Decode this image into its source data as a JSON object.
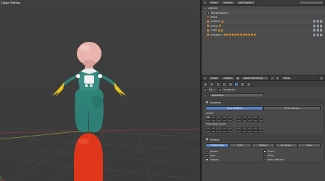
{
  "viewport": {
    "label": "User Ortho",
    "colors": {
      "background": "#3d3d3d",
      "skin": "#e8b4ad",
      "teal": "#2e8077",
      "yellow": "#e6c21c",
      "red": "#e0361a"
    }
  },
  "outliner_header": {
    "view": "View",
    "search": "Search",
    "scenes": "All Scenes"
  },
  "outliner": {
    "items": [
      {
        "label": "Untitled"
      },
      {
        "label": "RenderLayers"
      },
      {
        "label": "World"
      },
      {
        "label": "Camera"
      },
      {
        "label": "Lamp"
      },
      {
        "label": "Cube"
      },
      {
        "label": "Armature"
      }
    ]
  },
  "props_header": {
    "view": "View",
    "image": "Image",
    "datablock": "AB0TUSE:0026",
    "view2": "View"
  },
  "breadcrumb": {
    "object": "Fig",
    "data": "Armature"
  },
  "name_field": "Armature",
  "skeleton": {
    "title": "Skeleton",
    "pose_position": "Pose Position",
    "rest_position": "Rest Position",
    "layers_label": "Layers:",
    "protected_label": "Protected Layers:"
  },
  "display": {
    "title": "Display",
    "tabs": [
      "Octahedral",
      "Stick",
      "B-Bone",
      "Envelope",
      "Wire"
    ],
    "options": [
      {
        "label": "Names",
        "checked": false
      },
      {
        "label": "Colors",
        "checked": true
      },
      {
        "label": "Axes",
        "checked": false
      },
      {
        "label": "X-Ray",
        "checked": false
      },
      {
        "label": "Shapes",
        "checked": true
      },
      {
        "label": "Delay Refresh",
        "checked": false
      }
    ]
  }
}
